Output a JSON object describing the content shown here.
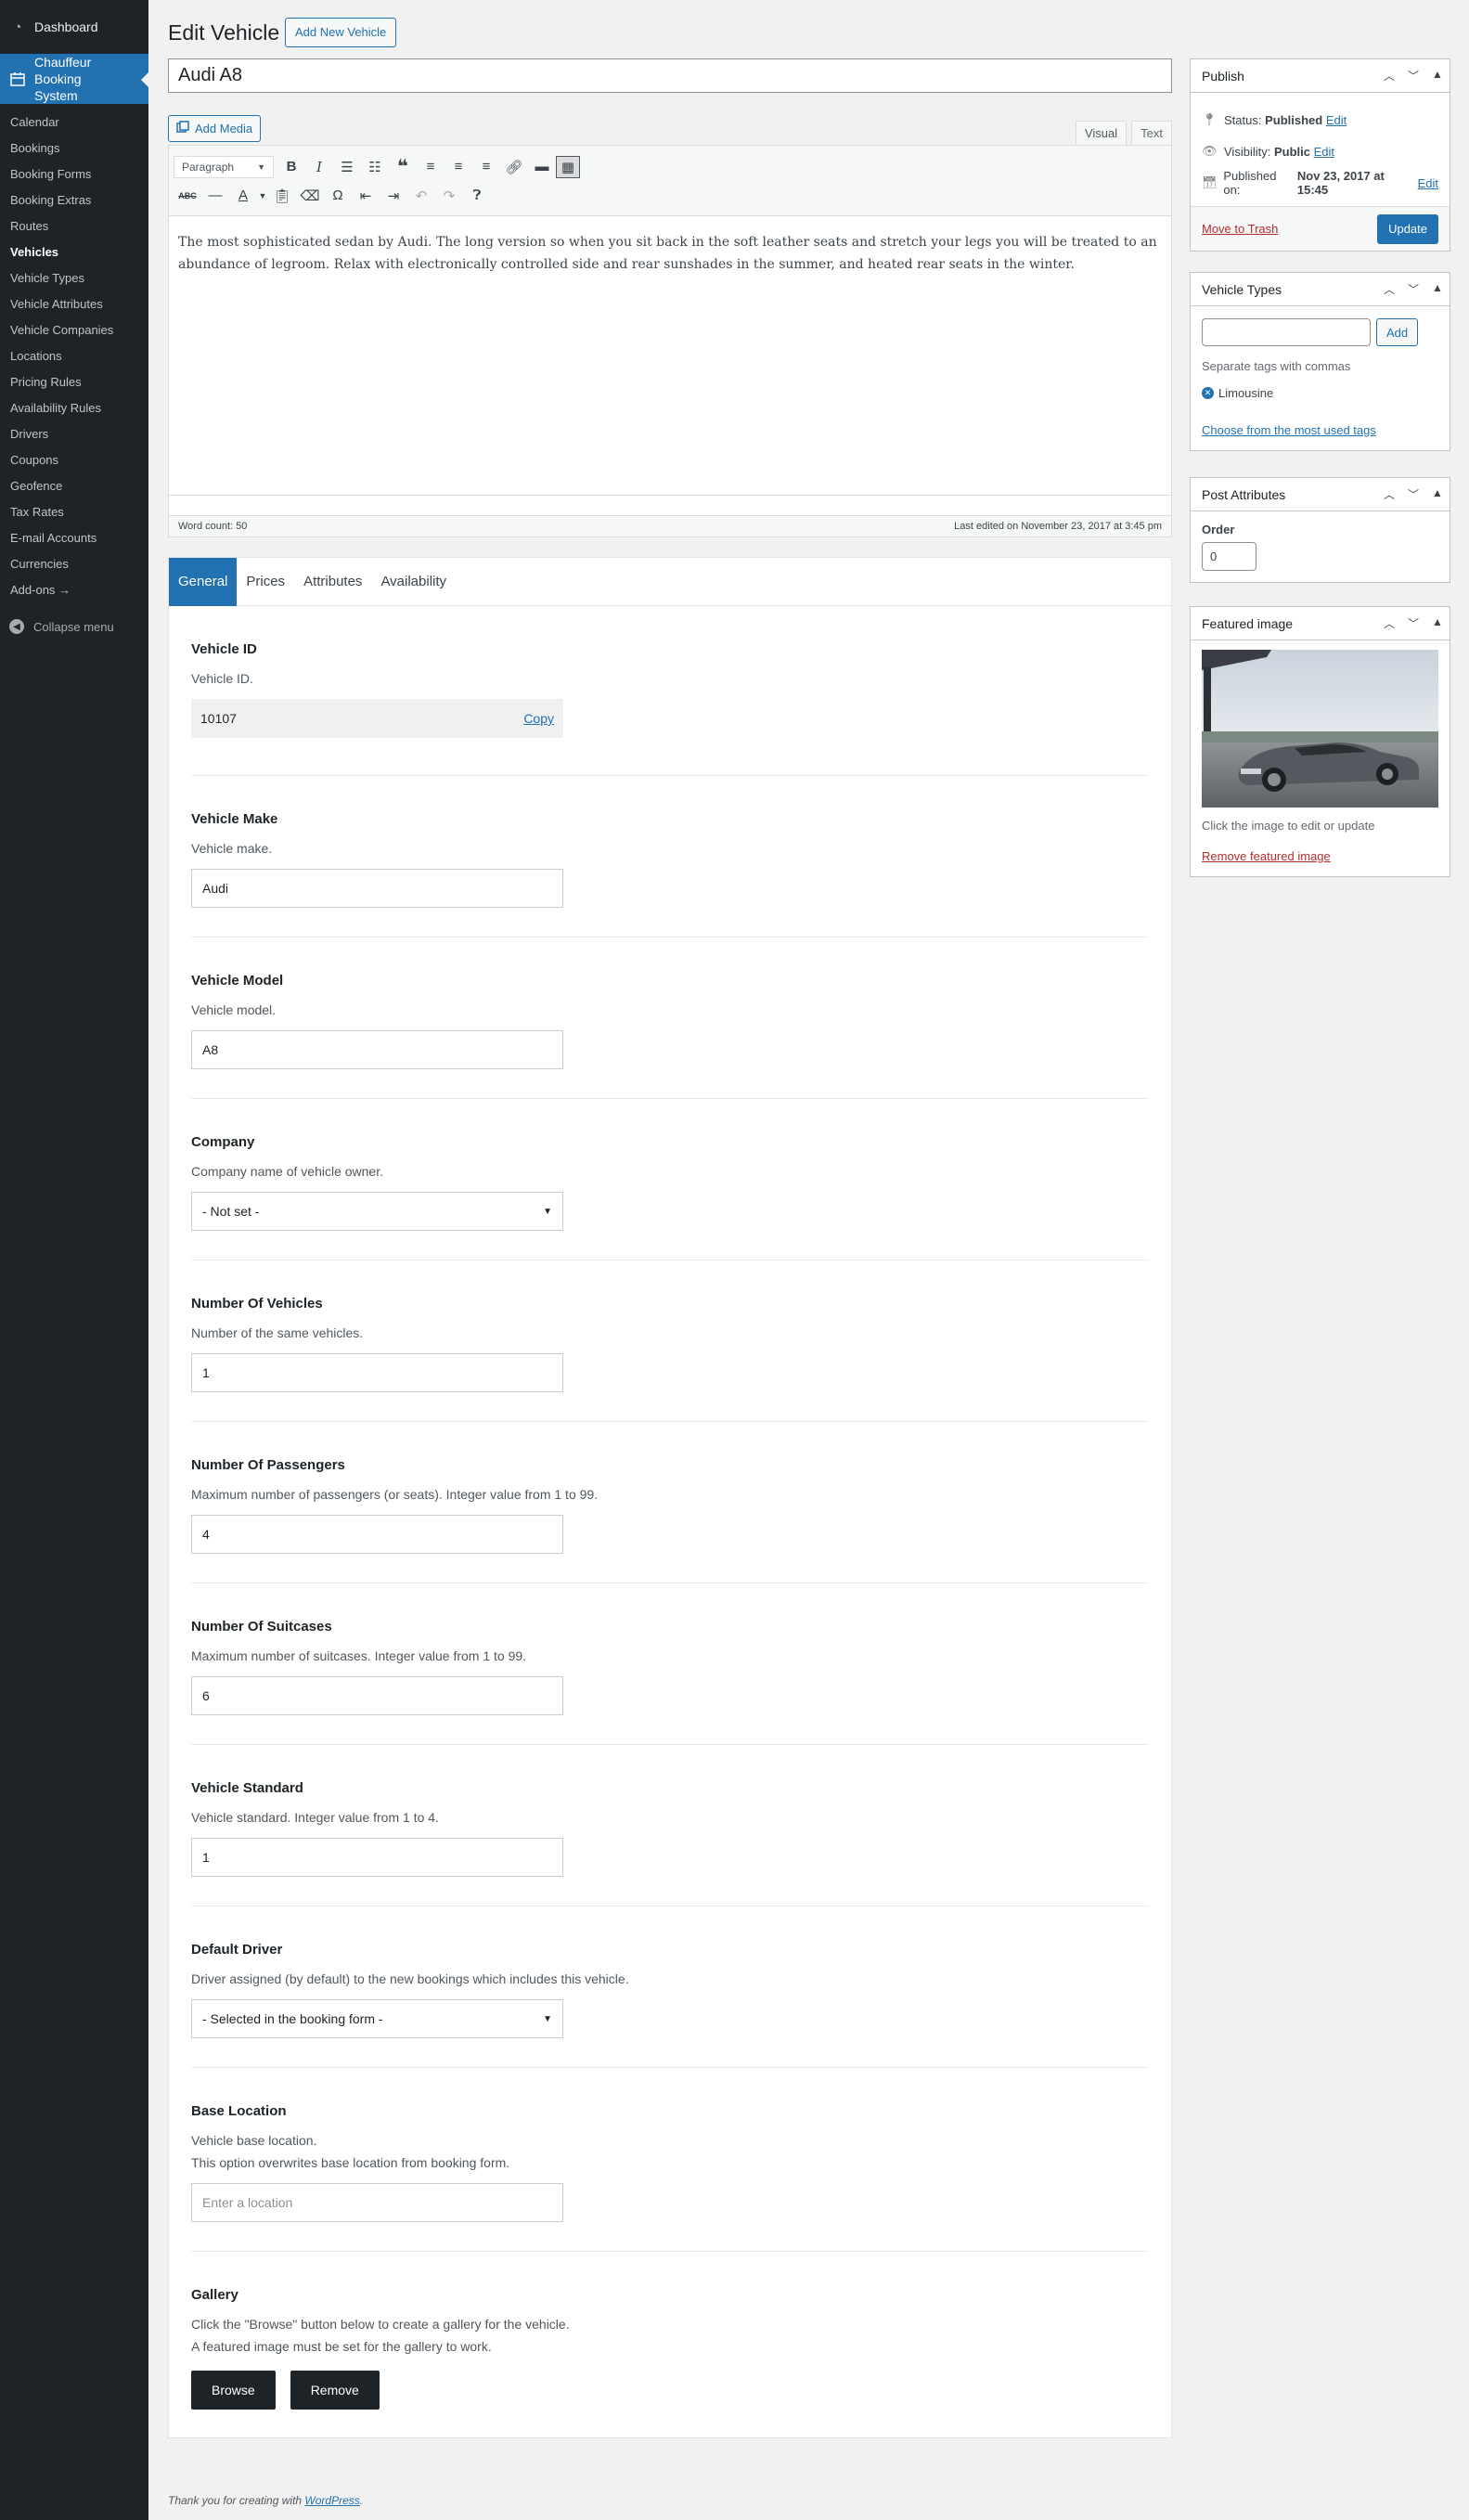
{
  "sidebar": {
    "dashboard": "Dashboard",
    "active_menu": "Chauffeur Booking System",
    "items": [
      "Calendar",
      "Bookings",
      "Booking Forms",
      "Booking Extras",
      "Routes",
      "Vehicles",
      "Vehicle Types",
      "Vehicle Attributes",
      "Vehicle Companies",
      "Locations",
      "Pricing Rules",
      "Availability Rules",
      "Drivers",
      "Coupons",
      "Geofence",
      "Tax Rates",
      "E-mail Accounts",
      "Currencies",
      "Add-ons →"
    ],
    "current": "Vehicles",
    "collapse": "Collapse menu"
  },
  "header": {
    "title": "Edit Vehicle",
    "add_new": "Add New Vehicle"
  },
  "post_title": "Audi A8",
  "editor": {
    "add_media": "Add Media",
    "tab_visual": "Visual",
    "tab_text": "Text",
    "format": "Paragraph",
    "content": "The most sophisticated sedan by Audi. The long version so when you sit back in the soft leather seats and stretch your legs you will be treated to an abundance of legroom. Relax with electronically controlled side and rear sunshades in the summer, and heated rear seats in the winter.",
    "word_count": "Word count: 50",
    "last_edited": "Last edited on November 23, 2017 at 3:45 pm"
  },
  "panel_tabs": [
    "General",
    "Prices",
    "Attributes",
    "Availability"
  ],
  "fields": {
    "vehicle_id": {
      "title": "Vehicle ID",
      "desc": "Vehicle ID.",
      "value": "10107",
      "copy": "Copy"
    },
    "make": {
      "title": "Vehicle Make",
      "desc": "Vehicle make.",
      "value": "Audi"
    },
    "model": {
      "title": "Vehicle Model",
      "desc": "Vehicle model.",
      "value": "A8"
    },
    "company": {
      "title": "Company",
      "desc": "Company name of vehicle owner.",
      "value": "- Not set -"
    },
    "num_vehicles": {
      "title": "Number Of Vehicles",
      "desc": "Number of the same vehicles.",
      "value": "1"
    },
    "num_passengers": {
      "title": "Number Of Passengers",
      "desc": "Maximum number of passengers (or seats). Integer value from 1 to 99.",
      "value": "4"
    },
    "num_suitcases": {
      "title": "Number Of Suitcases",
      "desc": "Maximum number of suitcases. Integer value from 1 to 99.",
      "value": "6"
    },
    "standard": {
      "title": "Vehicle Standard",
      "desc": "Vehicle standard. Integer value from 1 to 4.",
      "value": "1"
    },
    "driver": {
      "title": "Default Driver",
      "desc": "Driver assigned (by default) to the new bookings which includes this vehicle.",
      "value": "- Selected in the booking form -"
    },
    "location": {
      "title": "Base Location",
      "desc1": "Vehicle base location.",
      "desc2": "This option overwrites base location from booking form.",
      "placeholder": "Enter a location"
    },
    "gallery": {
      "title": "Gallery",
      "desc1": "Click the \"Browse\" button below to create a gallery for the vehicle.",
      "desc2": "A featured image must be set for the gallery to work.",
      "browse": "Browse",
      "remove": "Remove"
    }
  },
  "publish": {
    "title": "Publish",
    "status_label": "Status:",
    "status_value": "Published",
    "visibility_label": "Visibility:",
    "visibility_value": "Public",
    "published_label": "Published on:",
    "published_value": "Nov 23, 2017 at 15:45",
    "edit": "Edit",
    "trash": "Move to Trash",
    "update": "Update"
  },
  "vehicle_types": {
    "title": "Vehicle Types",
    "add": "Add",
    "hint": "Separate tags with commas",
    "tag": "Limousine",
    "most_used": "Choose from the most used tags"
  },
  "post_attributes": {
    "title": "Post Attributes",
    "order_label": "Order",
    "order_value": "0"
  },
  "featured": {
    "title": "Featured image",
    "hint": "Click the image to edit or update",
    "remove": "Remove featured image"
  },
  "footer": {
    "text": "Thank you for creating with",
    "link": "WordPress",
    "end": "."
  }
}
